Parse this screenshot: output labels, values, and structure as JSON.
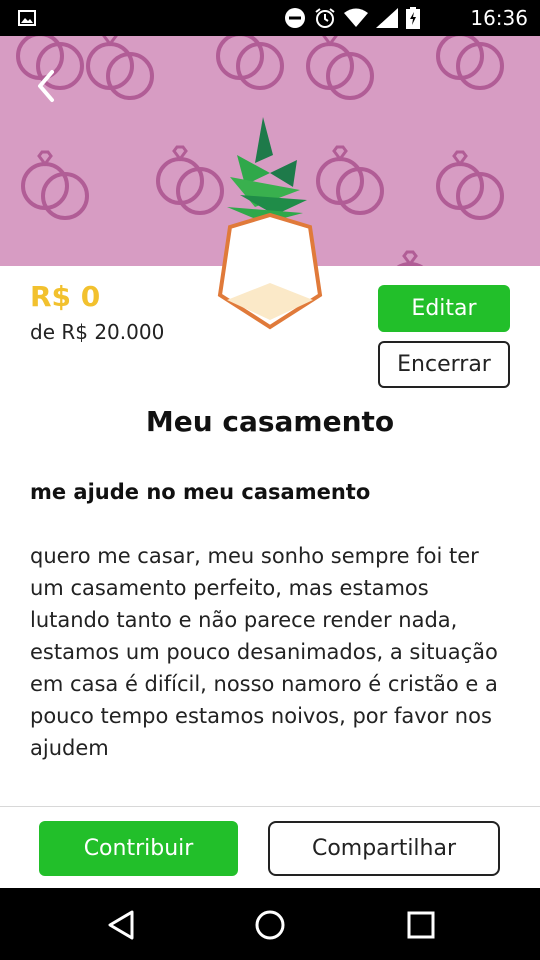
{
  "status_bar": {
    "time": "16:36",
    "icons": [
      "image-icon",
      "dnd-icon",
      "alarm-icon",
      "wifi-icon",
      "signal-icon",
      "battery-icon"
    ]
  },
  "colors": {
    "hero_bg": "#d79cc3",
    "accent_green": "#22bf2a",
    "amount_yellow": "#f2c12e"
  },
  "campaign": {
    "raised": "R$ 0",
    "goal": "de R$ 20.000",
    "title": "Meu casamento",
    "subtitle": "me ajude no meu casamento",
    "description": "quero me casar, meu sonho sempre foi ter um casamento perfeito, mas estamos lutando tanto e não parece render nada, estamos um pouco desanimados, a situação em casa é difícil, nosso namoro é cristão e a pouco tempo estamos noivos, por favor nos ajudem"
  },
  "actions": {
    "edit": "Editar",
    "close": "Encerrar",
    "contribute": "Contribuir",
    "share": "Compartilhar"
  },
  "nav_bar": {
    "items": [
      "back-icon",
      "home-icon",
      "recents-icon"
    ]
  }
}
